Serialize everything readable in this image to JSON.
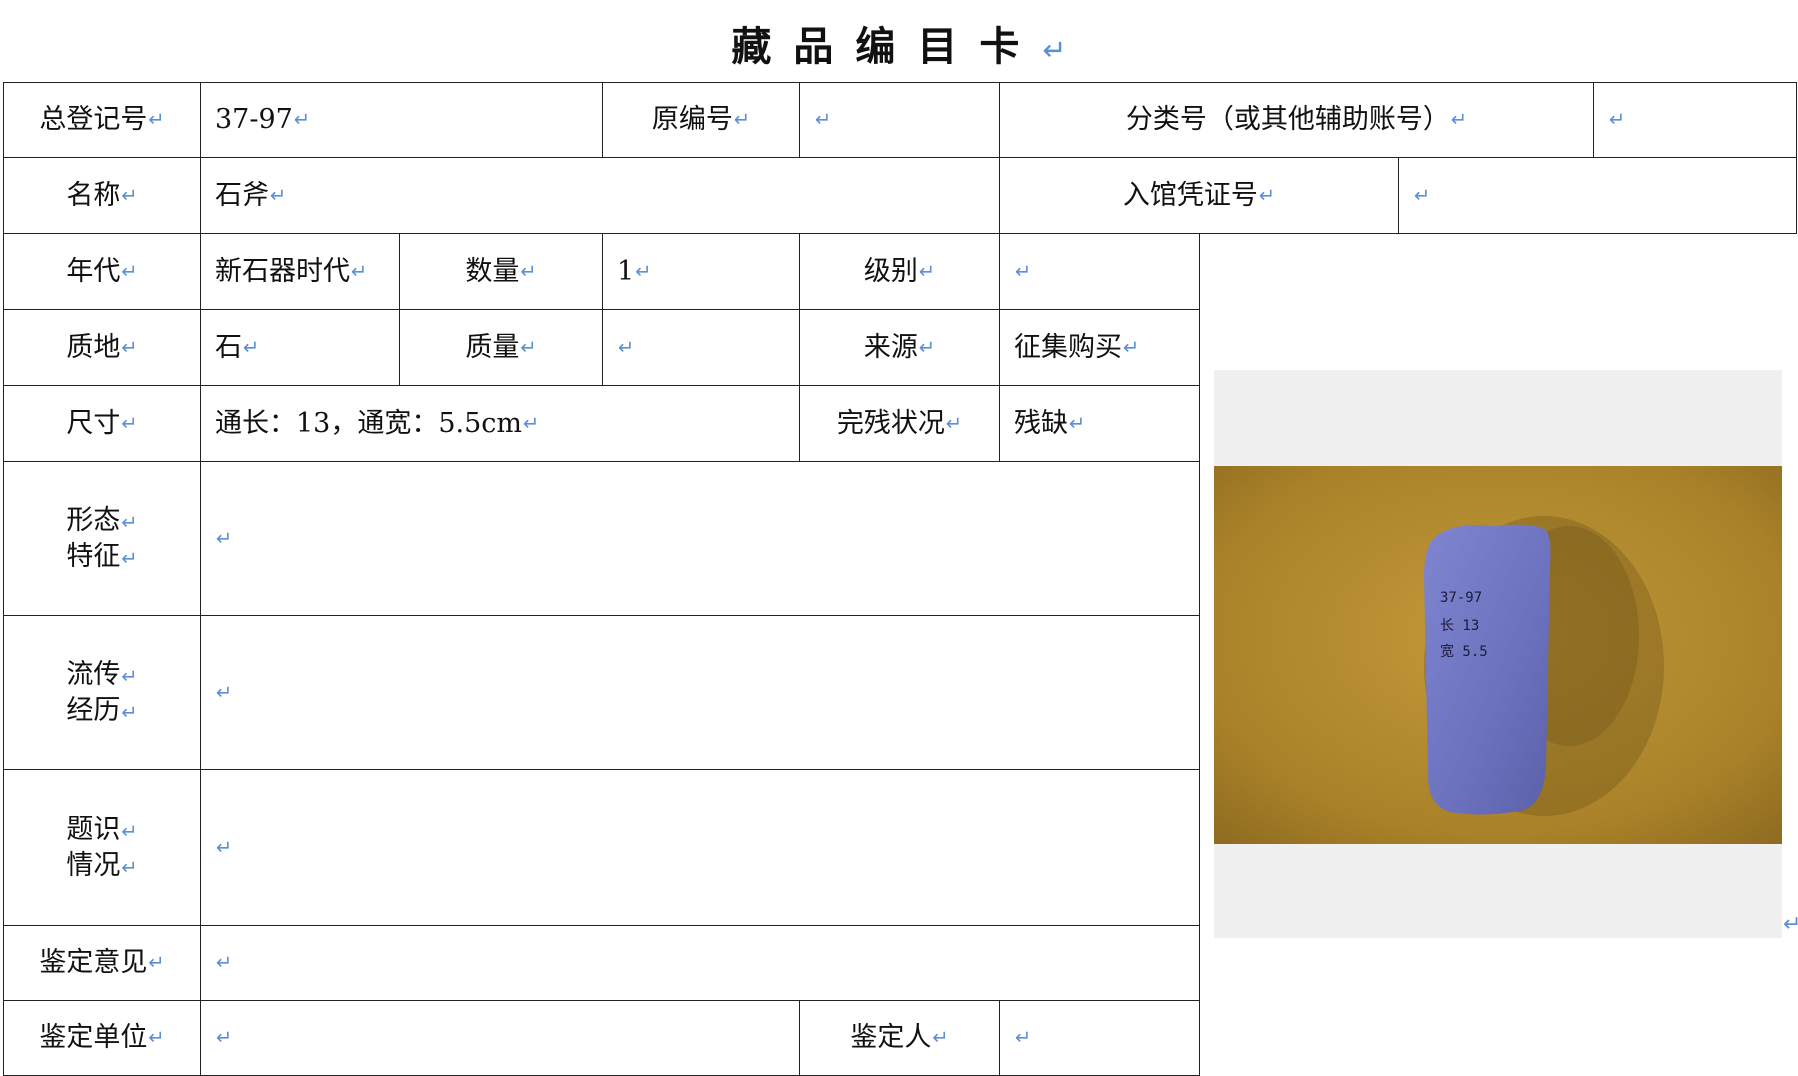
{
  "title": "藏品编目卡",
  "fields": {
    "reg_no_label": "总登记号",
    "reg_no_value": "37-97",
    "orig_no_label": "原编号",
    "orig_no_value": "",
    "class_no_label": "分类号（或其他辅助账号）",
    "class_no_value": "",
    "name_label": "名称",
    "name_value": "石斧",
    "voucher_label": "入馆凭证号",
    "voucher_value": "",
    "era_label": "年代",
    "era_value": "新石器时代",
    "qty_label": "数量",
    "qty_value": "1",
    "grade_label": "级别",
    "grade_value": "",
    "material_label": "质地",
    "material_value": "石",
    "mass_label": "质量",
    "mass_value": "",
    "source_label": "来源",
    "source_value": "征集购买",
    "size_label": "尺寸",
    "size_value": "通长：13，通宽：5.5cm",
    "condition_label": "完残状况",
    "condition_value": "残缺",
    "form_label_1": "形态",
    "form_label_2": "特征",
    "form_value": "",
    "history_label_1": "流传",
    "history_label_2": "经历",
    "history_value": "",
    "inscription_label_1": "题识",
    "inscription_label_2": "情况",
    "inscription_value": "",
    "opinion_label": "鉴定意见",
    "opinion_value": "",
    "unit_label": "鉴定单位",
    "unit_value": "",
    "appraiser_label": "鉴定人",
    "appraiser_value": ""
  },
  "photo": {
    "label_lines": [
      "37-97",
      "长 13",
      "宽 5.5"
    ],
    "background_color": "#b48a2e",
    "object_color": "#7076c0"
  },
  "colors": {
    "return_mark": "#5b8fd6",
    "border": "#222222"
  }
}
